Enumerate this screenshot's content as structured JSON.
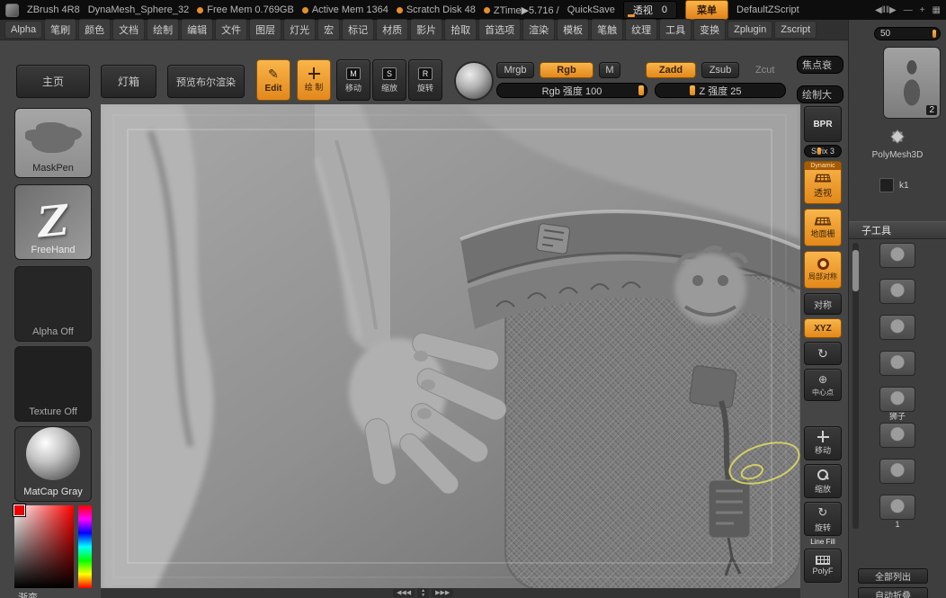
{
  "colors": {
    "orange": "#ef9431",
    "annotation": "#d8d265"
  },
  "titlebar": {
    "app": "ZBrush 4R8",
    "document": "DynaMesh_Sphere_32",
    "stats": [
      {
        "label": "Free Mem 0.769GB"
      },
      {
        "label": "Active Mem 1364"
      },
      {
        "label": "Scratch Disk 48"
      },
      {
        "label": "ZTime▶5.716 /"
      }
    ],
    "quicksave": "QuickSave",
    "perspective_label": "透视",
    "perspective_value": "0",
    "menu_button": "菜单",
    "zscript": "DefaultZScript",
    "icons": {
      "media": "◀‖‖▶",
      "minus": "—",
      "plus": "+",
      "grid": "▦"
    }
  },
  "menubar": {
    "items": [
      "Alpha",
      "笔刷",
      "颜色",
      "文档",
      "绘制",
      "编辑",
      "文件",
      "图层",
      "灯光",
      "宏",
      "标记",
      "材质",
      "影片",
      "拾取",
      "首选项",
      "渲染",
      "模板",
      "笔触",
      "纹理",
      "工具",
      "变换",
      "Zplugin",
      "Zscript"
    ]
  },
  "topshelf": {
    "home": "主页",
    "lightbox": "灯箱",
    "preview_boolean": "预览布尔渲染",
    "edit": "Edit",
    "draw": "绘 制",
    "move": "移动",
    "move_key": "M",
    "scale": "缩放",
    "scale_key": "S",
    "rotate": "旋转",
    "rotate_key": "R",
    "mrgb": "Mrgb",
    "rgb": "Rgb",
    "m": "M",
    "zadd": "Zadd",
    "zsub": "Zsub",
    "zcut": "Zcut",
    "rgb_intensity": "Rgb 强度 100",
    "z_intensity": "Z 强度 25",
    "focal_shift": "焦点衰",
    "draw_size": "绘制大"
  },
  "left_tray": {
    "brush": "MaskPen",
    "stroke": "FreeHand",
    "stroke_glyph": "Z",
    "alpha": "Alpha Off",
    "texture": "Texture Off",
    "material": "MatCap Gray",
    "gradient_label": "渐变"
  },
  "right_shelf": {
    "bpr": "BPR",
    "spix": "SPix 3",
    "dynamic": "Dynamic",
    "persp": "透视",
    "floor": "地面栅",
    "local_sym": "局部对称",
    "sym": "对称",
    "xyz": "XYZ",
    "rotate_view_icon": "↻",
    "frame_icon": "⊕",
    "frame": "中心点",
    "scroll": "移动",
    "zoom": "缩放",
    "rotate": "旋转",
    "line_fill": "Line Fill",
    "polyf": "PolyF"
  },
  "right_panel": {
    "top_value": "50",
    "tool_badge": "2",
    "tool_name": "PolyMesh3D",
    "brush_label": "k1",
    "subtool_header": "子工具",
    "subtools": [
      {
        "label": ""
      },
      {
        "label": ""
      },
      {
        "label": ""
      },
      {
        "label": ""
      },
      {
        "label": "狮子"
      },
      {
        "label": ""
      },
      {
        "label": ""
      },
      {
        "label": "1"
      }
    ],
    "list_all": "全部列出",
    "auto_collapse": "自动折叠"
  },
  "nav": {
    "left": "◀◀◀",
    "up": "▲",
    "down": "▼",
    "right": "▶▶▶"
  }
}
